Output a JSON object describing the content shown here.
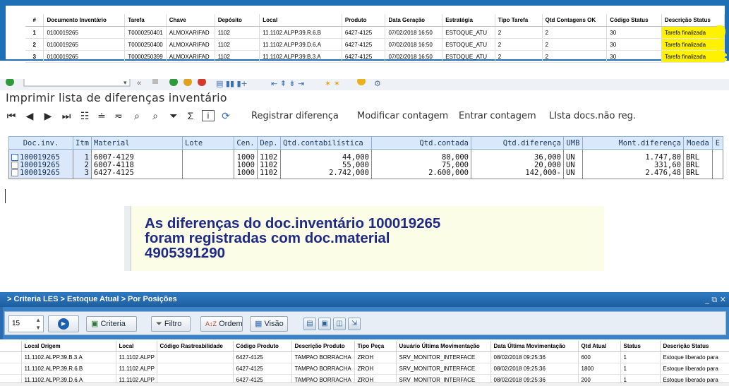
{
  "task_table": {
    "columns": [
      "#",
      "Documento Inventário",
      "Tarefa",
      "Chave",
      "Depósito",
      "Local",
      "Produto",
      "Data Geração",
      "Estratégia",
      "Tipo Tarefa",
      "Qtd Contagens OK",
      "Código Status",
      "Descrição Status"
    ],
    "rows": [
      [
        "1",
        "0100019265",
        "T0000250401",
        "ALMOXARIFAD",
        "1102",
        "11.1102.ALPP.39.R.6.B",
        "6427-4125",
        "07/02/2018 16:50",
        "ESTOQUE_ATU",
        "2",
        "2",
        "30",
        "Tarefa finalizada"
      ],
      [
        "2",
        "0100019265",
        "T0000250400",
        "ALMOXARIFAD",
        "1102",
        "11.1102.ALPP.39.D.6.A",
        "6427-4125",
        "07/02/2018 16:50",
        "ESTOQUE_ATU",
        "2",
        "2",
        "30",
        "Tarefa finalizada"
      ],
      [
        "3",
        "0100019265",
        "T0000250399",
        "ALMOXARIFAD",
        "1102",
        "11.1102.ALPP.39.B.3.A",
        "6427-4125",
        "07/02/2018 16:50",
        "ESTOQUE_ATU",
        "2",
        "2",
        "30",
        "Tarefa finalizada"
      ]
    ],
    "highlight_color": "#fff100",
    "annotation_color": "#fff100"
  },
  "sap": {
    "title": "Imprimir lista de diferenças inventário",
    "actions": [
      "Registrar diferença",
      "Modificar contagem",
      "Entrar contagem",
      "LIsta docs.não reg."
    ],
    "columns": [
      "Doc.inv.",
      "Itm",
      "Material",
      "Lote",
      "Cen.",
      "Dep.",
      "Qtd.contabilística",
      "Qtd.contada",
      "Qtd.diferença",
      "UMB",
      "Mont.diferença",
      "Moeda",
      "E"
    ],
    "rows": [
      [
        "100019265",
        "1",
        "6007-4129",
        "",
        "1000",
        "1102",
        "44,000",
        "80,000",
        "36,000",
        "UN",
        "1.747,80",
        "BRL"
      ],
      [
        "100019265",
        "2",
        "6007-4118",
        "",
        "1000",
        "1102",
        "55,000",
        "75,000",
        "20,000",
        "UN",
        "331,60",
        "BRL"
      ],
      [
        "100019265",
        "3",
        "6427-4125",
        "",
        "1000",
        "1102",
        "2.742,000",
        "2.600,000",
        "142,000-",
        "UN",
        "2.476,48",
        "BRL"
      ]
    ]
  },
  "message": {
    "text": "As diferenças do doc.inventário 100019265\nforam registradas com doc.material\n4905391290"
  },
  "criteria": {
    "breadcrumb": "> Criteria LES > Estoque Atual > Por Posições",
    "window_controls": "_ ⧉ ✕",
    "rows_per_page": "15",
    "buttons": {
      "criteria": "Criteria",
      "filtro": "Filtro",
      "ordem": "Ordem",
      "visao": "Visão"
    },
    "columns": [
      "",
      "Local Origem",
      "Local",
      "Código Rastreabilidade",
      "Código Produto",
      "Descrição Produto",
      "Tipo Peça",
      "Usuário Última Movimentação",
      "Data Última Movimentação",
      "Qtd Atual",
      "Status",
      "Descrição Status"
    ],
    "rows": [
      [
        "",
        "11.1102.ALPP.39.B.3.A",
        "11.1102.ALPP",
        "",
        "6427-4125",
        "TAMPAO BORRACHA",
        "ZROH",
        "SRV_MONITOR_INTERFACE",
        "08/02/2018 09:25:36",
        "600",
        "1",
        "Estoque liberado para"
      ],
      [
        "",
        "11.1102.ALPP.39.R.6.B",
        "11.1102.ALPP",
        "",
        "6427-4125",
        "TAMPAO BORRACHA",
        "ZROH",
        "SRV_MONITOR_INTERFACE",
        "08/02/2018 09:25:36",
        "1800",
        "1",
        "Estoque liberado para"
      ],
      [
        "",
        "11.1102.ALPP.39.D.6.A",
        "11.1102.ALPP",
        "",
        "6427-4125",
        "TAMPAO BORRACHA",
        "ZROH",
        "SRV_MONITOR_INTERFACE",
        "08/02/2018 09:25:36",
        "200",
        "1",
        "Estoque liberado para"
      ]
    ],
    "accent_color": "#2f7bc4"
  }
}
